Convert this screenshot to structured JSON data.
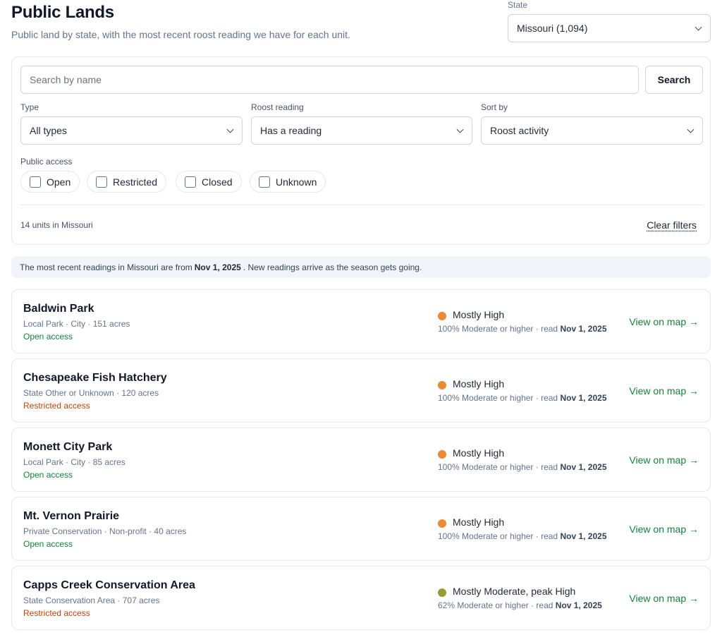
{
  "header": {
    "title": "Public Lands",
    "subtitle": "Public land by state, with the most recent roost reading we have for each unit."
  },
  "state_picker": {
    "label": "State",
    "value": "Missouri (1,094)"
  },
  "search": {
    "placeholder": "Search by name",
    "value": "",
    "button_label": "Search"
  },
  "filters": {
    "type": {
      "label": "Type",
      "value": "All types"
    },
    "roost_reading": {
      "label": "Roost reading",
      "value": "Has a reading"
    },
    "sort_by": {
      "label": "Sort by",
      "value": "Roost activity"
    },
    "public_access": {
      "label": "Public access",
      "options": [
        {
          "label": "Open",
          "checked": false
        },
        {
          "label": "Restricted",
          "checked": false
        },
        {
          "label": "Closed",
          "checked": false
        },
        {
          "label": "Unknown",
          "checked": false
        }
      ]
    },
    "results_count": "14 units in Missouri",
    "clear_label": "Clear filters"
  },
  "notice": {
    "prefix": "The most recent readings in Missouri are from",
    "date": "Nov 1, 2025",
    "suffix": ". New readings arrive as the season gets going."
  },
  "colors": {
    "high": "#ea8a34",
    "moderate": "#9a9a33",
    "open_access": "#15803d",
    "restricted_access": "#c2410c",
    "link": "#15803d"
  },
  "units": [
    {
      "name": "Baldwin Park",
      "meta": "Local Park · City · 151 acres",
      "access": "Open access",
      "access_kind": "open",
      "reading": "Mostly High",
      "dot_color": "#ea8a34",
      "detail": "100% Moderate or higher · read",
      "date": "Nov 1, 2025",
      "link": "View on map →"
    },
    {
      "name": "Chesapeake Fish Hatchery",
      "meta": "State Other or Unknown · 120 acres",
      "access": "Restricted access",
      "access_kind": "restricted",
      "reading": "Mostly High",
      "dot_color": "#ea8a34",
      "detail": "100% Moderate or higher · read",
      "date": "Nov 1, 2025",
      "link": "View on map →"
    },
    {
      "name": "Monett City Park",
      "meta": "Local Park · City · 85 acres",
      "access": "Open access",
      "access_kind": "open",
      "reading": "Mostly High",
      "dot_color": "#ea8a34",
      "detail": "100% Moderate or higher · read",
      "date": "Nov 1, 2025",
      "link": "View on map →"
    },
    {
      "name": "Mt. Vernon Prairie",
      "meta": "Private Conservation · Non-profit · 40 acres",
      "access": "Open access",
      "access_kind": "open",
      "reading": "Mostly High",
      "dot_color": "#ea8a34",
      "detail": "100% Moderate or higher · read",
      "date": "Nov 1, 2025",
      "link": "View on map →"
    },
    {
      "name": "Capps Creek Conservation Area",
      "meta": "State Conservation Area · 707 acres",
      "access": "Restricted access",
      "access_kind": "restricted",
      "reading": "Mostly Moderate, peak High",
      "dot_color": "#9a9a33",
      "detail": "62% Moderate or higher · read",
      "date": "Nov 1, 2025",
      "link": "View on map →"
    }
  ]
}
